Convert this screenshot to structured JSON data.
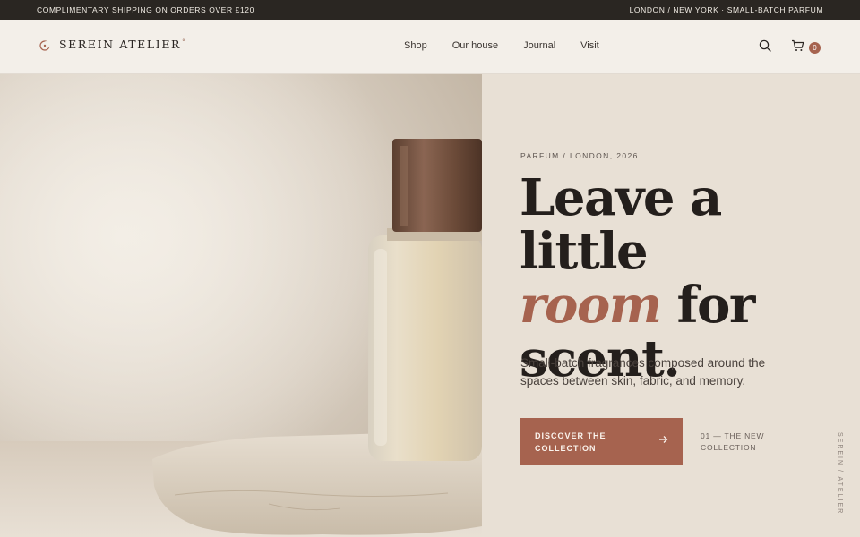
{
  "announcement": {
    "left": "COMPLIMENTARY SHIPPING ON ORDERS OVER £120",
    "right": "LONDON / NEW YORK · SMALL-BATCH PARFUM"
  },
  "brand": {
    "name": "SEREIN ATELIER",
    "mark": "°"
  },
  "nav": {
    "items": [
      "Shop",
      "Our house",
      "Journal",
      "Visit"
    ]
  },
  "cart": {
    "count": "0"
  },
  "hero": {
    "eyebrow": "PARFUM / LONDON, 2026",
    "headline_line1": "Leave a little",
    "headline_accent": "room",
    "headline_line2_rest": " for",
    "headline_line3": "scent.",
    "subcopy": "Small-batch fragrances composed around the spaces between skin, fabric, and memory.",
    "cta_label_1": "DISCOVER THE",
    "cta_label_2": "COLLECTION",
    "collection_note": "01 — THE NEW COLLECTION",
    "vertical_brand": "SEREIN / ATELIER"
  },
  "colors": {
    "accent": "#a6634f",
    "dark": "#2a2622",
    "panel": "#e8e0d5",
    "background": "#f3efe9"
  },
  "icons": {
    "search": "search-icon",
    "cart": "cart-icon",
    "arrow": "arrow-right-icon",
    "logo": "crescent-logo-icon"
  }
}
